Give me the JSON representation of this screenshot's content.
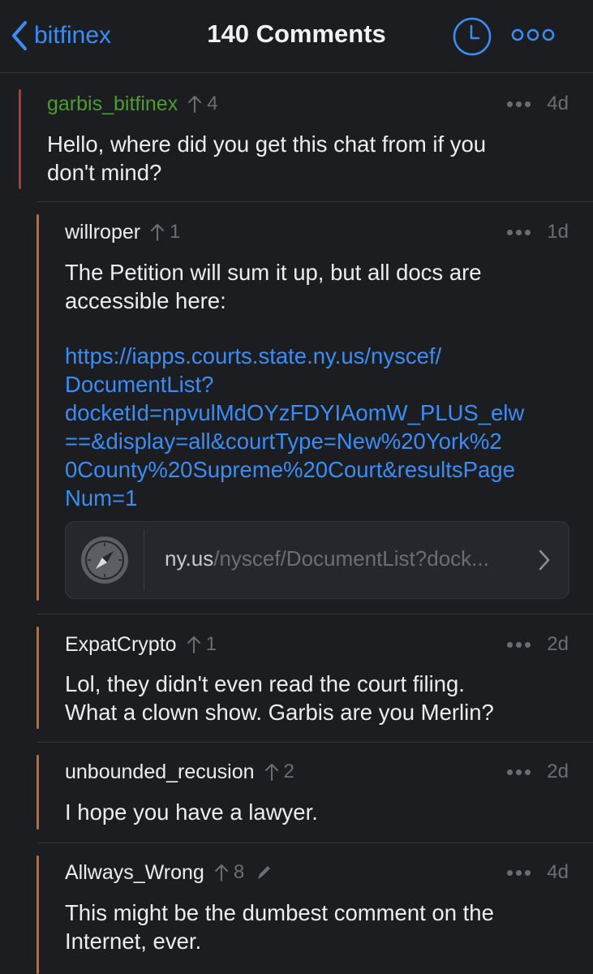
{
  "nav": {
    "back_label": "bitfinex",
    "title": "140 Comments"
  },
  "colors": {
    "accent": "#3a8df5",
    "background": "#1c1d21",
    "op_green": "#4c9c2e",
    "thread_red": "#b23a32",
    "thread_orange": "#c56a2c",
    "muted": "#6c6d73"
  },
  "comments": [
    {
      "author": "garbis_bitfinex",
      "score": "4",
      "age": "4d",
      "body": [
        "Hello, where did you get this chat from if you",
        "don't mind?"
      ]
    },
    {
      "author": "willroper",
      "score": "1",
      "age": "1d",
      "body": [
        "The Petition will sum it up, but all docs are",
        "accessible here:"
      ],
      "link_lines": [
        "https://iapps.courts.state.ny.us/nyscef/",
        "DocumentList?",
        "docketId=npvulMdOYzFDYIAomW_PLUS_elw",
        "==&display=all&courtType=New%20York%2",
        "0County%20Supreme%20Court&resultsPage",
        "Num=1"
      ],
      "link_card": {
        "domain": "ny.us",
        "path": "/nyscef/DocumentList?dock..."
      }
    },
    {
      "author": "ExpatCrypto",
      "score": "1",
      "age": "2d",
      "body": [
        "Lol, they didn't even read the court filing.",
        "What a clown show.  Garbis are you Merlin?"
      ]
    },
    {
      "author": "unbounded_recusion",
      "score": "2",
      "age": "2d",
      "body": [
        "I hope you have a lawyer."
      ]
    },
    {
      "author": "Allways_Wrong",
      "score": "8",
      "age": "4d",
      "body": [
        "This might be the dumbest comment on the",
        "Internet, ever."
      ]
    }
  ]
}
